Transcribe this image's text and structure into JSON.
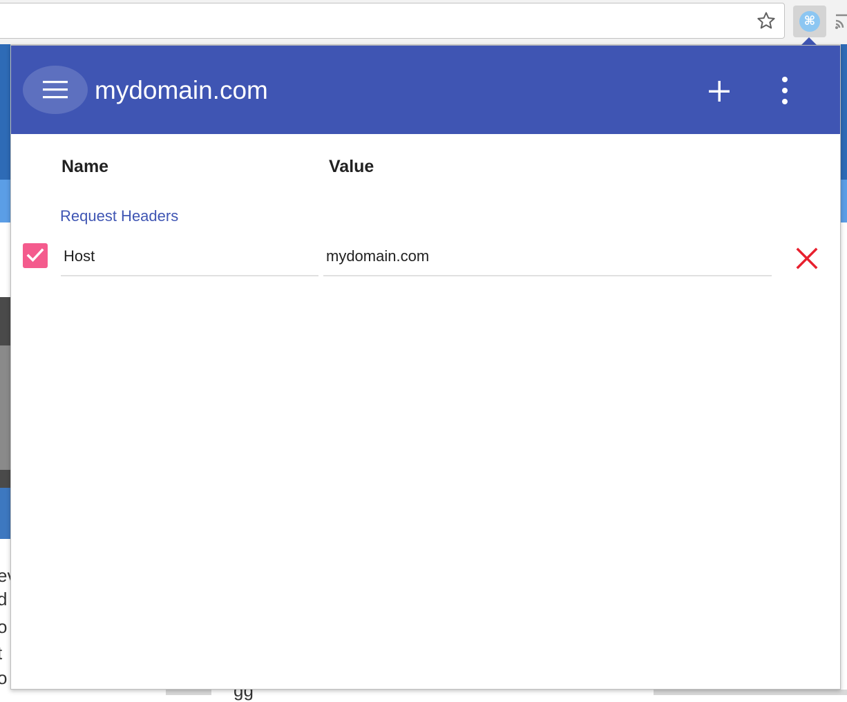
{
  "background": {
    "left_text_lines": [
      "ev",
      "d",
      "o",
      "t",
      "o j"
    ],
    "bottom_text": "gg"
  },
  "popup": {
    "title": "mydomain.com",
    "columns": {
      "name": "Name",
      "value": "Value"
    },
    "section_label": "Request Headers",
    "headers": [
      {
        "enabled": true,
        "name": "Host",
        "value": "mydomain.com"
      }
    ]
  },
  "colors": {
    "app_bar": "#3f55b3",
    "checkbox": "#f45b8d",
    "delete": "#e8202e",
    "section_label": "#3f55b3"
  },
  "icons": {
    "toolbar": [
      "star-icon",
      "extension-icon",
      "cast-icon"
    ],
    "app_bar": [
      "menu-icon",
      "add-icon",
      "more-vert-icon"
    ],
    "row": [
      "check-icon",
      "close-icon"
    ],
    "extension_glyph": "⌘"
  }
}
